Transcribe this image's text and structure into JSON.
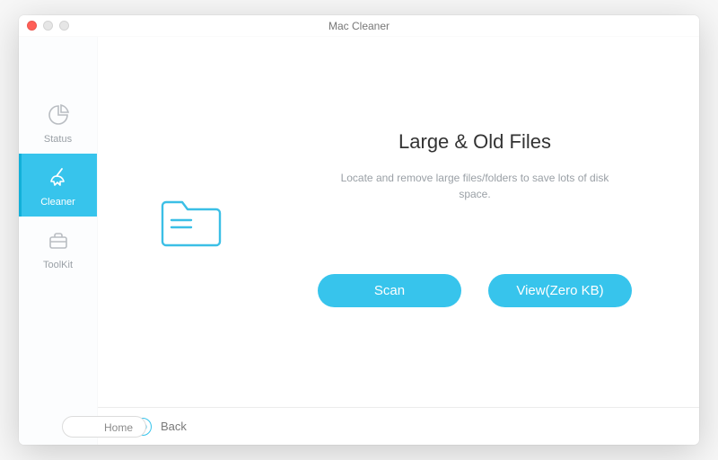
{
  "window": {
    "title": "Mac Cleaner"
  },
  "sidebar": {
    "items": [
      {
        "label": "Status"
      },
      {
        "label": "Cleaner"
      },
      {
        "label": "ToolKit"
      }
    ]
  },
  "main": {
    "heading": "Large & Old Files",
    "subtext": "Locate and remove large files/folders to save lots of disk space."
  },
  "buttons": {
    "scan": "Scan",
    "view": "View(Zero KB)"
  },
  "footer": {
    "home": "Home",
    "back": "Back"
  }
}
